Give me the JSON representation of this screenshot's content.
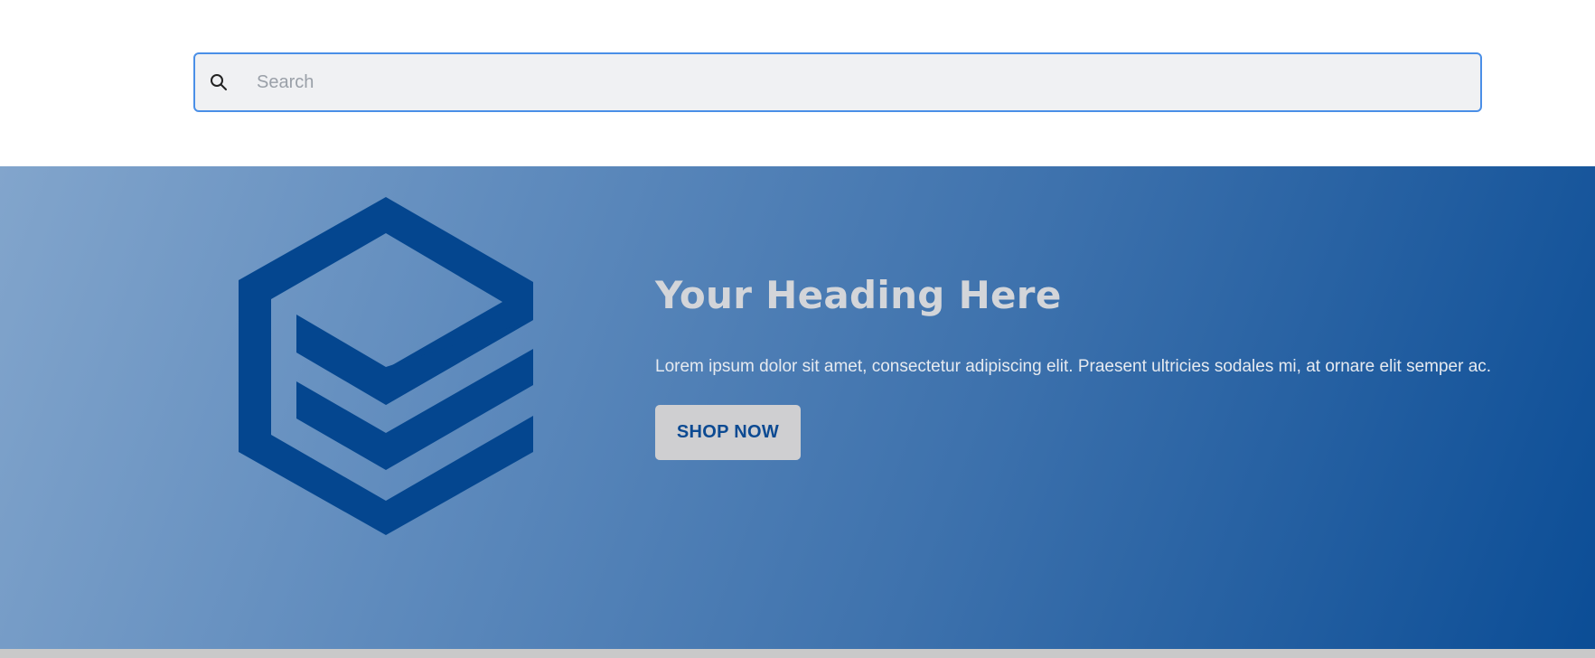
{
  "search": {
    "placeholder": "Search",
    "value": ""
  },
  "hero": {
    "logo_icon": "hexagon-cube-logo-icon",
    "heading": "Your Heading Here",
    "text": "Lorem ipsum dolor sit amet, consectetur adipiscing elit. Praesent ultricies sodales mi, at ornare elit semper ac.",
    "button_label": "SHOP NOW"
  },
  "colors": {
    "search_border": "#4a8fe7",
    "search_bg": "#f0f1f3",
    "hero_gradient_start": "#82a5cc",
    "hero_gradient_end": "#0b4d96",
    "logo": "#04468f",
    "heading": "#d3d5d9",
    "button_bg": "#cfcfd1",
    "button_text": "#0c4a92",
    "bottom_bar": "#c9c9c9"
  }
}
